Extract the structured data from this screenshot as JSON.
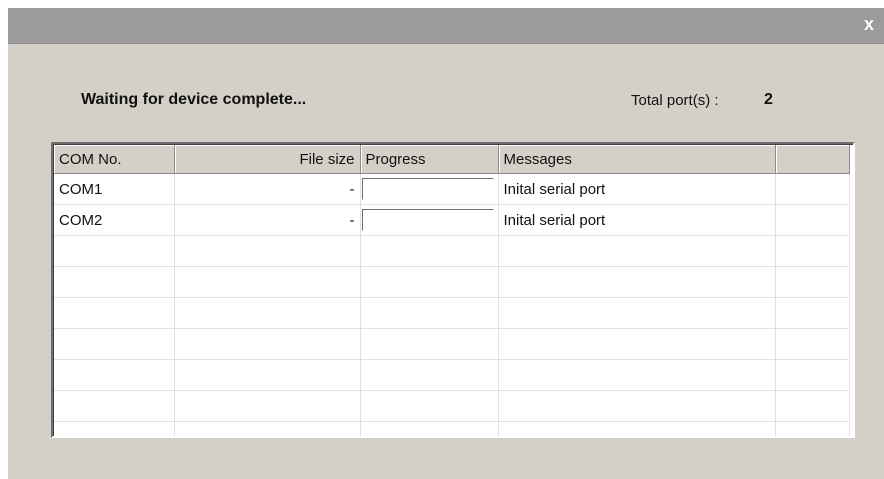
{
  "dialog": {
    "close_label": "x",
    "status_text": "Waiting for device complete...",
    "total_ports_label": "Total port(s) :",
    "total_ports_value": "2"
  },
  "table": {
    "columns": [
      "COM No.",
      "File size",
      "Progress",
      "Messages",
      ""
    ],
    "rows": [
      {
        "com": "COM1",
        "file_size": "-",
        "progress": 0,
        "message": "Inital serial port"
      },
      {
        "com": "COM2",
        "file_size": "-",
        "progress": 0,
        "message": "Inital serial port"
      },
      {
        "com": "",
        "file_size": "",
        "progress": null,
        "message": ""
      },
      {
        "com": "",
        "file_size": "",
        "progress": null,
        "message": ""
      },
      {
        "com": "",
        "file_size": "",
        "progress": null,
        "message": ""
      },
      {
        "com": "",
        "file_size": "",
        "progress": null,
        "message": ""
      },
      {
        "com": "",
        "file_size": "",
        "progress": null,
        "message": ""
      },
      {
        "com": "",
        "file_size": "",
        "progress": null,
        "message": ""
      },
      {
        "com": "",
        "file_size": "",
        "progress": null,
        "message": ""
      },
      {
        "com": "",
        "file_size": "",
        "progress": null,
        "message": ""
      }
    ]
  },
  "colors": {
    "titlebar": "#9b9b9b",
    "dialog_bg": "#d4d0c8",
    "grid_bg": "#ffffff"
  }
}
